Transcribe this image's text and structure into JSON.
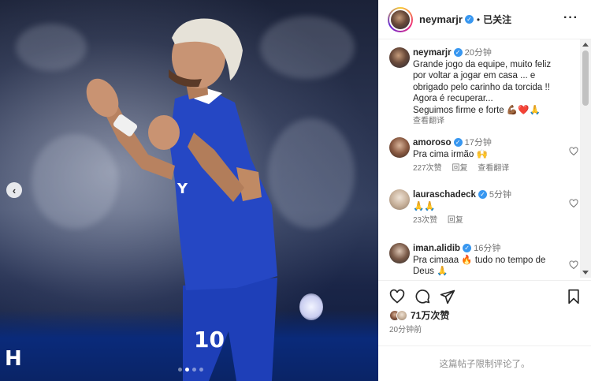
{
  "post": {
    "nav_prev_glyph": "‹",
    "carousel_dots": 4,
    "club_logo": "H"
  },
  "header": {
    "username": "neymarjr",
    "separator": "•",
    "follow_status": "已关注",
    "more_glyph": "···"
  },
  "caption": {
    "username": "neymarjr",
    "time": "20分钟",
    "line1": "Grande jogo da equipe, muito feliz",
    "line2": "por voltar a jogar em casa ... e",
    "line3": "obrigado pelo carinho da torcida !!",
    "line4": "Agora é recuperar...",
    "line5": "Seguimos firme e forte 💪🏾❤️🙏",
    "see_translation": "查看翻译"
  },
  "comments": [
    {
      "username": "amoroso",
      "time": "17分钟",
      "text": "Pra cima irmão 🙌",
      "likes": "227次赞",
      "reply": "回复",
      "translate": "查看翻译"
    },
    {
      "username": "lauraschadeck",
      "time": "5分钟",
      "text": "🙏🙏",
      "likes": "23次赞",
      "reply": "回复"
    },
    {
      "username": "iman.alidib",
      "time": "16分钟",
      "text1": "Pra cimaaa 🔥 tudo no tempo de",
      "text2": "Deus 🙏"
    }
  ],
  "footer": {
    "likes_count": "71万次赞",
    "post_time": "20分钟前",
    "comment_limit": "这篇帖子限制评论了。"
  },
  "colors": {
    "verified": "#3897f0",
    "muted": "#737373",
    "text": "#262626"
  }
}
